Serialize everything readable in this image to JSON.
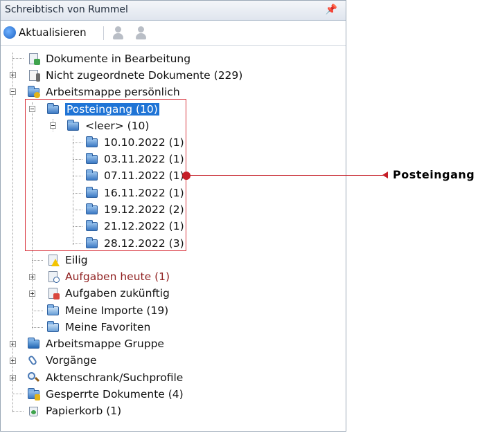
{
  "window": {
    "title": "Schreibtisch von Rummel",
    "pin_glyph": "📌"
  },
  "toolbar": {
    "refresh_label": "Aktualisieren",
    "icons": [
      "refresh-icon",
      "user-icon",
      "user-add-icon"
    ]
  },
  "tree": {
    "items": [
      {
        "label": "Dokumente in Bearbeitung",
        "icon": "document-edit-icon"
      },
      {
        "label": "Nicht zugeordnete Dokumente (229)",
        "icon": "unassigned-icon"
      },
      {
        "label": "Arbeitsmappe persönlich",
        "icon": "personal-folder-icon"
      },
      {
        "label": "Posteingang (10)",
        "icon": "folder-icon",
        "selected": true
      },
      {
        "label": "<leer> (10)",
        "icon": "folder-icon"
      },
      {
        "label": "10.10.2022 (1)",
        "icon": "folder-icon"
      },
      {
        "label": "03.11.2022 (1)",
        "icon": "folder-icon"
      },
      {
        "label": "07.11.2022 (1)",
        "icon": "folder-icon"
      },
      {
        "label": "16.11.2022 (1)",
        "icon": "folder-icon"
      },
      {
        "label": "19.12.2022 (2)",
        "icon": "folder-icon"
      },
      {
        "label": "21.12.2022 (1)",
        "icon": "folder-icon"
      },
      {
        "label": "28.12.2022 (3)",
        "icon": "folder-icon"
      },
      {
        "label": "Eilig",
        "icon": "urgent-icon"
      },
      {
        "label": "Aufgaben heute (1)",
        "icon": "tasks-today-icon",
        "color": "#8f1f1f"
      },
      {
        "label": "Aufgaben zukünftig",
        "icon": "tasks-future-icon"
      },
      {
        "label": "Meine Importe (19)",
        "icon": "imports-icon"
      },
      {
        "label": "Meine Favoriten",
        "icon": "favorites-icon"
      },
      {
        "label": "Arbeitsmappe Gruppe",
        "icon": "group-folder-icon"
      },
      {
        "label": "Vorgänge",
        "icon": "paperclip-icon"
      },
      {
        "label": "Aktenschrank/Suchprofile",
        "icon": "search-profile-icon"
      },
      {
        "label": "Gesperrte Dokumente (4)",
        "icon": "locked-icon"
      },
      {
        "label": "Papierkorb (1)",
        "icon": "recycle-bin-icon"
      }
    ]
  },
  "callout": {
    "label": "Posteingang",
    "color": "#c51d26"
  }
}
